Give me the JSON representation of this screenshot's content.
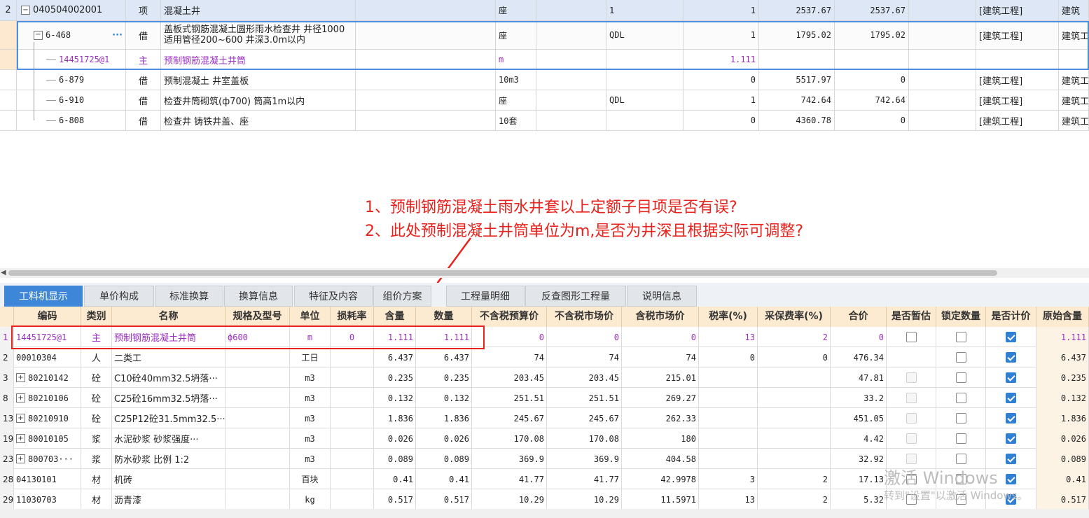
{
  "top_table": {
    "rows": [
      {
        "num": "2",
        "code": "040504002001",
        "type": "项",
        "name": "混凝土井",
        "unit": "座",
        "expr": "1",
        "qty": "1",
        "price": "2537.67",
        "total": "2537.67",
        "major": "[建筑工程]",
        "extra": "建筑"
      },
      {
        "num": "",
        "code": "6-468",
        "type": "借",
        "name": "盖板式钢筋混凝土圆形雨水检查井 井径1000 适用管径200~600 井深3.0m以内",
        "unit": "座",
        "expr": "QDL",
        "qty": "1",
        "price": "1795.02",
        "total": "1795.02",
        "major": "[建筑工程]",
        "extra": "建筑工"
      },
      {
        "num": "",
        "code": "14451725@1",
        "type": "主",
        "name": "预制钢筋混凝土井筒",
        "unit": "m",
        "expr": "",
        "qty": "1.111",
        "price": "",
        "total": "",
        "major": "",
        "extra": ""
      },
      {
        "num": "",
        "code": "6-879",
        "type": "借",
        "name": "预制混凝土 井室盖板",
        "unit": "10m3",
        "expr": "",
        "qty": "0",
        "price": "5517.97",
        "total": "0",
        "major": "[建筑工程]",
        "extra": "建筑工"
      },
      {
        "num": "",
        "code": "6-910",
        "type": "借",
        "name": "检查井筒砌筑(ф700) 筒高1m以内",
        "unit": "座",
        "expr": "QDL",
        "qty": "1",
        "price": "742.64",
        "total": "742.64",
        "major": "[建筑工程]",
        "extra": "建筑工"
      },
      {
        "num": "",
        "code": "6-808",
        "type": "借",
        "name": "检查井 铸铁井盖、座",
        "unit": "10套",
        "expr": "",
        "qty": "0",
        "price": "4360.78",
        "total": "0",
        "major": "[建筑工程]",
        "extra": "建筑工"
      }
    ],
    "more_glyph": "···"
  },
  "annotation": {
    "line1": "1、预制钢筋混凝土雨水井套以上定额子目项是否有误?",
    "line2": "2、此处预制混凝土井筒单位为m,是否为井深且根据实际可调整?",
    "color": "#e8221c"
  },
  "tabs": [
    {
      "label": "工料机显示",
      "active": true
    },
    {
      "label": "单价构成",
      "active": false
    },
    {
      "label": "标准换算",
      "active": false
    },
    {
      "label": "换算信息",
      "active": false
    },
    {
      "label": "特征及内容",
      "active": false
    },
    {
      "label": "组价方案",
      "active": false
    },
    {
      "label": "工程量明细",
      "active": false
    },
    {
      "label": "反查图形工程量",
      "active": false
    },
    {
      "label": "说明信息",
      "active": false
    }
  ],
  "grid": {
    "headers": [
      "编码",
      "类别",
      "名称",
      "规格及型号",
      "单位",
      "损耗率",
      "含量",
      "数量",
      "不含税预算价",
      "不含税市场价",
      "含税市场价",
      "税率(%)",
      "采保费率(%)",
      "合价",
      "是否暂估",
      "锁定数量",
      "是否计价",
      "原始含量"
    ],
    "rows": [
      {
        "num": "1",
        "code": "14451725@1",
        "type": "主",
        "name": "预制钢筋混凝土井筒",
        "spec": "ф600",
        "unit": "m",
        "loss": "0",
        "content": "1.111",
        "qty": "1.111",
        "pre": "0",
        "mkt": "0",
        "taxmkt": "0",
        "tax": "13",
        "fee": "2",
        "total": "0",
        "est": "empty",
        "lock": "empty",
        "price": "checked",
        "orig": "1.111",
        "purple": true,
        "expand": false
      },
      {
        "num": "2",
        "code": "00010304",
        "type": "人",
        "name": "二类工",
        "spec": "",
        "unit": "工日",
        "loss": "",
        "content": "6.437",
        "qty": "6.437",
        "pre": "74",
        "mkt": "74",
        "taxmkt": "74",
        "tax": "0",
        "fee": "0",
        "total": "476.34",
        "est": "none",
        "lock": "empty",
        "price": "checked",
        "orig": "6.437",
        "purple": false,
        "expand": false
      },
      {
        "num": "3",
        "code": "80210142",
        "type": "砼",
        "name": "C10砼40mm32.5坍落···",
        "spec": "",
        "unit": "m3",
        "loss": "",
        "content": "0.235",
        "qty": "0.235",
        "pre": "203.45",
        "mkt": "203.45",
        "taxmkt": "215.01",
        "tax": "",
        "fee": "",
        "total": "47.81",
        "est": "disabled",
        "lock": "empty",
        "price": "checked",
        "orig": "0.235",
        "purple": false,
        "expand": true
      },
      {
        "num": "8",
        "code": "80210106",
        "type": "砼",
        "name": "C25砼16mm32.5坍落···",
        "spec": "",
        "unit": "m3",
        "loss": "",
        "content": "0.132",
        "qty": "0.132",
        "pre": "251.51",
        "mkt": "251.51",
        "taxmkt": "269.27",
        "tax": "",
        "fee": "",
        "total": "33.2",
        "est": "disabled",
        "lock": "empty",
        "price": "checked",
        "orig": "0.132",
        "purple": false,
        "expand": true
      },
      {
        "num": "13",
        "code": "80210910",
        "type": "砼",
        "name": "C25P12砼31.5mm32.5···",
        "spec": "",
        "unit": "m3",
        "loss": "",
        "content": "1.836",
        "qty": "1.836",
        "pre": "245.67",
        "mkt": "245.67",
        "taxmkt": "262.33",
        "tax": "",
        "fee": "",
        "total": "451.05",
        "est": "disabled",
        "lock": "empty",
        "price": "checked",
        "orig": "1.836",
        "purple": false,
        "expand": true
      },
      {
        "num": "19",
        "code": "80010105",
        "type": "浆",
        "name": "水泥砂浆 砂浆强度···",
        "spec": "",
        "unit": "m3",
        "loss": "",
        "content": "0.026",
        "qty": "0.026",
        "pre": "170.08",
        "mkt": "170.08",
        "taxmkt": "180",
        "tax": "",
        "fee": "",
        "total": "4.42",
        "est": "disabled",
        "lock": "empty",
        "price": "checked",
        "orig": "0.026",
        "purple": false,
        "expand": true
      },
      {
        "num": "23",
        "code": "800703···",
        "type": "浆",
        "name": "防水砂浆 比例 1:2",
        "spec": "",
        "unit": "m3",
        "loss": "",
        "content": "0.089",
        "qty": "0.089",
        "pre": "369.9",
        "mkt": "369.9",
        "taxmkt": "404.58",
        "tax": "",
        "fee": "",
        "total": "32.92",
        "est": "disabled",
        "lock": "empty",
        "price": "checked",
        "orig": "0.089",
        "purple": false,
        "expand": true
      },
      {
        "num": "28",
        "code": "04130101",
        "type": "材",
        "name": "机砖",
        "spec": "",
        "unit": "百块",
        "loss": "",
        "content": "0.41",
        "qty": "0.41",
        "pre": "41.77",
        "mkt": "41.77",
        "taxmkt": "42.9978",
        "tax": "3",
        "fee": "2",
        "total": "17.13",
        "est": "empty",
        "lock": "empty",
        "price": "checked",
        "orig": "0.41",
        "purple": false,
        "expand": false
      },
      {
        "num": "29",
        "code": "11030703",
        "type": "材",
        "name": "沥青漆",
        "spec": "",
        "unit": "kg",
        "loss": "",
        "content": "0.517",
        "qty": "0.517",
        "pre": "10.29",
        "mkt": "10.29",
        "taxmkt": "11.5971",
        "tax": "13",
        "fee": "2",
        "total": "5.32",
        "est": "empty",
        "lock": "empty",
        "price": "checked",
        "orig": "0.517",
        "purple": false,
        "expand": false
      }
    ]
  },
  "watermark": {
    "line1": "激活 Windows",
    "line2": "转到\"设置\"以激活 Windows。"
  }
}
